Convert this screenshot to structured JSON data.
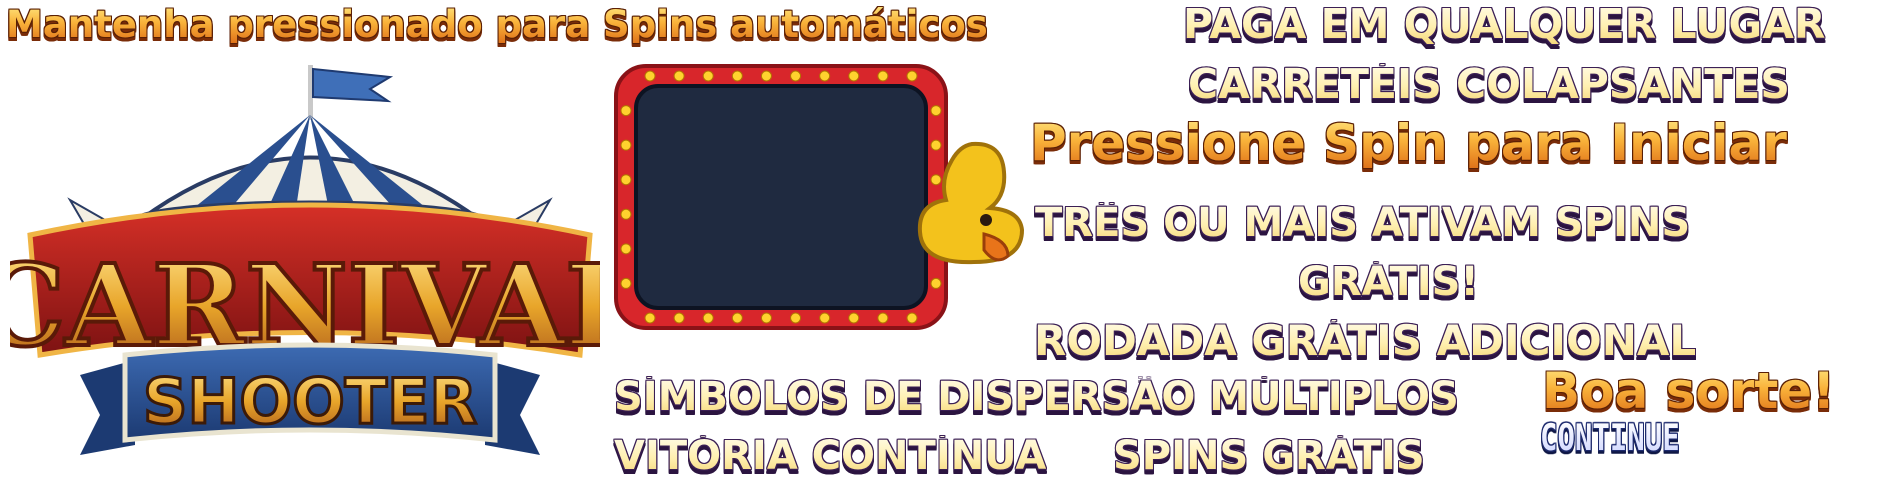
{
  "instructions": {
    "hold_autospin": "Mantenha pressionado para Spins automáticos",
    "press_spin": "Pressione Spin para Iniciar",
    "good_luck": "Boa sorte!",
    "continue": "CONTINUE"
  },
  "features": {
    "pays_anywhere": "PAGA EM QUALQUER LUGAR",
    "collapsing_reels": "CARRETÉIS COLAPSANTES",
    "three_or_more_line1": "TRÊS OU MAIS ATIVAM SPINS",
    "three_or_more_line2": "GRÁTIS!",
    "extra_free_round": "RODADA GRÁTIS ADICIONAL",
    "multiple_scatters": "SÍMBOLOS DE DISPERSÃO MÚLTIPLOS",
    "continuous_win": "VITÓRIA CONTÍNUA",
    "free_spins": "SPINS GRÁTIS"
  },
  "logo": {
    "line1": "CARNIVAL",
    "line2": "SHOOTER"
  },
  "colors": {
    "orange_text": "#f6a21a",
    "cream_text": "#fff3c2",
    "outline_purple": "#3b1f55",
    "board_red": "#d8262b",
    "board_screen": "#1f2a40",
    "bulb_yellow": "#ffd22e",
    "duck_yellow": "#f3c21c",
    "tent_blue": "#2a4f8f"
  },
  "icons": {
    "logo": "carnival-tent-logo",
    "board": "marquee-board-icon",
    "duck": "duck-target-icon"
  }
}
